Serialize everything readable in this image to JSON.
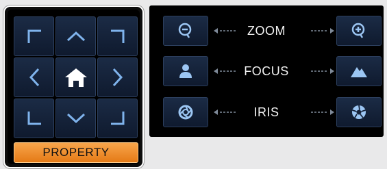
{
  "ptz_pad": {
    "buttons": [
      {
        "icon": "arrow-up-left-icon"
      },
      {
        "icon": "arrow-up-icon"
      },
      {
        "icon": "arrow-up-right-icon"
      },
      {
        "icon": "arrow-left-icon"
      },
      {
        "icon": "home-icon"
      },
      {
        "icon": "arrow-right-icon"
      },
      {
        "icon": "arrow-down-left-icon"
      },
      {
        "icon": "arrow-down-icon"
      },
      {
        "icon": "arrow-down-right-icon"
      }
    ],
    "property_label": "PROPERTY"
  },
  "controls": {
    "zoom": {
      "label": "ZOOM",
      "left_icon": "zoom-out-icon",
      "right_icon": "zoom-in-icon"
    },
    "focus": {
      "label": "FOCUS",
      "left_icon": "focus-near-icon",
      "right_icon": "focus-far-icon"
    },
    "iris": {
      "label": "IRIS",
      "left_icon": "iris-close-icon",
      "right_icon": "iris-open-icon"
    }
  },
  "colors": {
    "icon": "#7fb3ec",
    "property_button": "#f08d2a",
    "button_bg": "#16233a"
  }
}
